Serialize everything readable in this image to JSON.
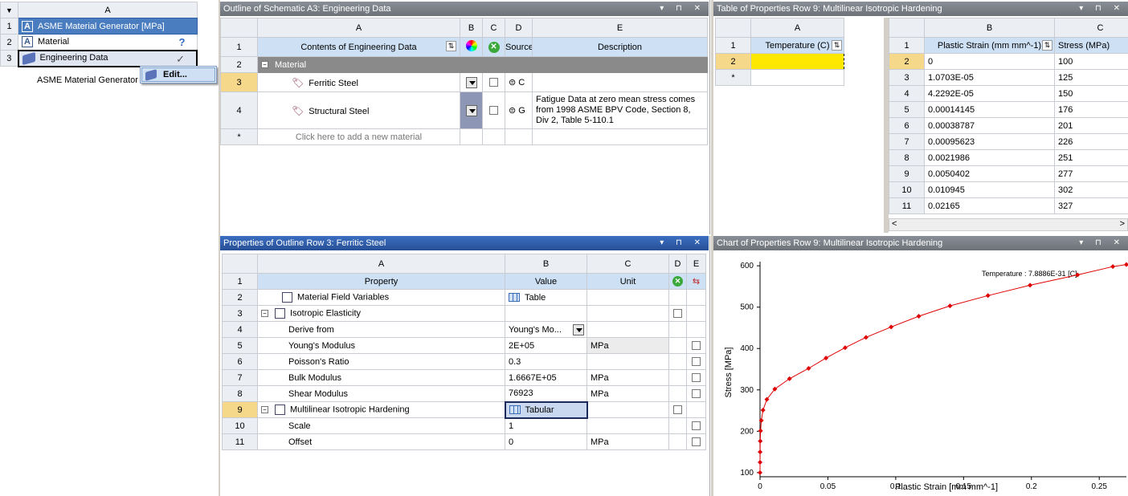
{
  "schematic": {
    "col_letter": "A",
    "rows": [
      {
        "num": "1",
        "label": "ASME Material Generator [MPa]",
        "icon": "letter-a-icon"
      },
      {
        "num": "2",
        "label": "Material",
        "icon": "letter-a-icon",
        "status": "?"
      },
      {
        "num": "3",
        "label": "Engineering Data",
        "icon": "book-icon",
        "status": "✓"
      }
    ],
    "caption": "ASME Material Generator",
    "context_menu": {
      "edit": "Edit..."
    }
  },
  "outline": {
    "title": "Outline of Schematic A3: Engineering Data",
    "cols": [
      "A",
      "B",
      "C",
      "D",
      "E"
    ],
    "header": {
      "contents": "Contents of Engineering Data",
      "source": "Source",
      "description": "Description"
    },
    "rows": [
      {
        "num": "1"
      },
      {
        "num": "2",
        "label": "Material"
      },
      {
        "num": "3",
        "label": "Ferritic Steel",
        "source_abbr": "C",
        "description": ""
      },
      {
        "num": "4",
        "label": "Structural Steel",
        "source_abbr": "G",
        "description": "Fatigue Data at zero mean stress comes from 1998 ASME BPV Code, Section 8, Div 2, Table 5-110.1"
      },
      {
        "num": "*",
        "label": "Click here to add a new material"
      }
    ]
  },
  "properties": {
    "title": "Properties of Outline Row 3: Ferritic Steel",
    "cols": [
      "A",
      "B",
      "C",
      "D",
      "E"
    ],
    "header": {
      "property": "Property",
      "value": "Value",
      "unit": "Unit"
    },
    "rows": [
      {
        "num": "2",
        "name": "Material Field Variables",
        "value": "Table",
        "unit": ""
      },
      {
        "num": "3",
        "name": "Isotropic Elasticity",
        "value": "",
        "unit": ""
      },
      {
        "num": "4",
        "name": "Derive from",
        "value": "Young's Mo...",
        "unit": ""
      },
      {
        "num": "5",
        "name": "Young's Modulus",
        "value": "2E+05",
        "unit": "MPa"
      },
      {
        "num": "6",
        "name": "Poisson's Ratio",
        "value": "0.3",
        "unit": ""
      },
      {
        "num": "7",
        "name": "Bulk Modulus",
        "value": "1.6667E+05",
        "unit": "MPa"
      },
      {
        "num": "8",
        "name": "Shear Modulus",
        "value": "76923",
        "unit": "MPa"
      },
      {
        "num": "9",
        "name": "Multilinear Isotropic Hardening",
        "value": "Tabular",
        "unit": ""
      },
      {
        "num": "10",
        "name": "Scale",
        "value": "1",
        "unit": ""
      },
      {
        "num": "11",
        "name": "Offset",
        "value": "0",
        "unit": "MPa"
      }
    ]
  },
  "table_props": {
    "title": "Table of Properties Row 9: Multilinear Isotropic Hardening",
    "temp_col": "A",
    "temp_header": "Temperature (C)",
    "temp_rows": [
      "1",
      "2",
      "*"
    ],
    "data_cols": [
      "B",
      "C"
    ],
    "strain_header": "Plastic Strain (mm mm^-1)",
    "stress_header": "Stress (MPa)",
    "rows": [
      {
        "num": "1"
      },
      {
        "num": "2",
        "strain": "0",
        "stress": "100"
      },
      {
        "num": "3",
        "strain": "1.0703E-05",
        "stress": "125"
      },
      {
        "num": "4",
        "strain": "4.2292E-05",
        "stress": "150"
      },
      {
        "num": "5",
        "strain": "0.00014145",
        "stress": "176"
      },
      {
        "num": "6",
        "strain": "0.00038787",
        "stress": "201"
      },
      {
        "num": "7",
        "strain": "0.00095623",
        "stress": "226"
      },
      {
        "num": "8",
        "strain": "0.0021986",
        "stress": "251"
      },
      {
        "num": "9",
        "strain": "0.0050402",
        "stress": "277"
      },
      {
        "num": "10",
        "strain": "0.010945",
        "stress": "302"
      },
      {
        "num": "11",
        "strain": "0.02165",
        "stress": "327"
      }
    ]
  },
  "chart_panel": {
    "title": "Chart of Properties Row 9: Multilinear Isotropic Hardening"
  },
  "chart_data": {
    "type": "line",
    "title": "",
    "xlabel": "Plastic Strain  [mm mm^-1]",
    "ylabel": "Stress  [MPa]",
    "xlim": [
      0,
      0.27
    ],
    "ylim": [
      90,
      610
    ],
    "xticks": [
      "0",
      "0.05",
      "0.1",
      "0.15",
      "0.2",
      "0.25"
    ],
    "xtick_values": [
      0,
      0.05,
      0.1,
      0.15,
      0.2,
      0.25
    ],
    "yticks": [
      "100",
      "200",
      "300",
      "400",
      "500",
      "600"
    ],
    "ytick_values": [
      100,
      200,
      300,
      400,
      500,
      600
    ],
    "annotation": "Temperature : 7.8886E-31 [C]",
    "color": "#e00000",
    "x": [
      0,
      1.07e-05,
      4.23e-05,
      0.000141,
      0.000388,
      0.000956,
      0.0022,
      0.00504,
      0.0109,
      0.0217,
      0.0358,
      0.0486,
      0.0627,
      0.0781,
      0.0966,
      0.117,
      0.14,
      0.168,
      0.199,
      0.234,
      0.26,
      0.27
    ],
    "y": [
      100,
      125,
      150,
      176,
      201,
      226,
      251,
      277,
      302,
      327,
      352,
      377,
      402,
      427,
      452,
      478,
      503,
      528,
      553,
      578,
      598,
      603
    ]
  }
}
